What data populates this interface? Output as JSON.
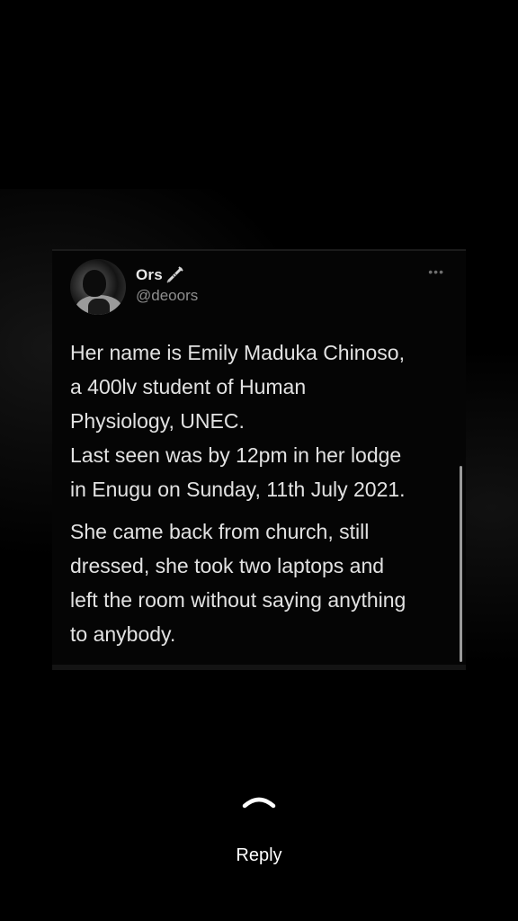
{
  "tweet": {
    "display_name": "Ors",
    "name_emoji": "syringe-icon",
    "handle": "@deoors",
    "more_icon": "more-horizontal-icon",
    "paragraph_1_lines": [
      "Her name is Emily Maduka Chinoso,",
      "a 400lv student of Human",
      "Physiology, UNEC.",
      "Last seen was by 12pm in her lodge",
      "in Enugu on Sunday, 11th July 2021."
    ],
    "paragraph_2_lines": [
      "She came back from church, still",
      "dressed, she took two laptops and",
      "left the room without saying anything",
      "to anybody."
    ]
  },
  "reply": {
    "icon": "chevron-up-icon",
    "label": "Reply"
  },
  "colors": {
    "background": "#000000",
    "text": "#e2e2e2",
    "handle": "#8e8e8e"
  }
}
